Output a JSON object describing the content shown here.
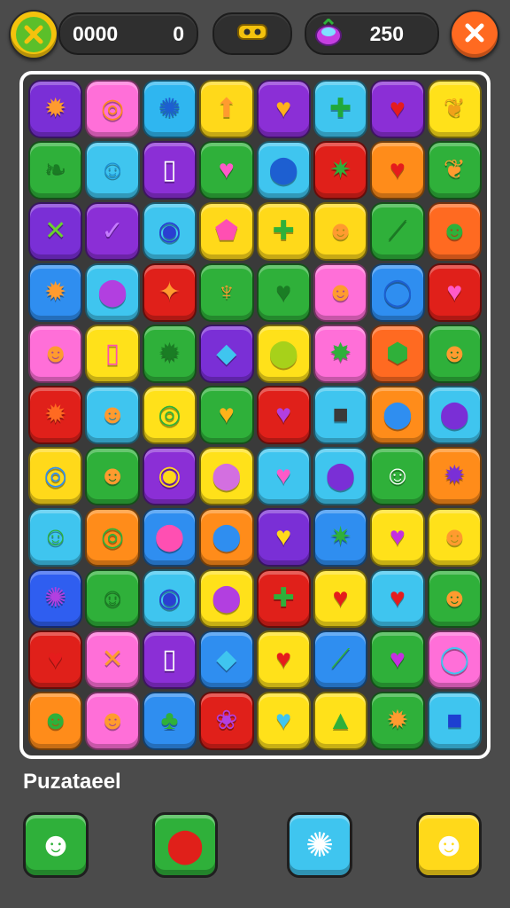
{
  "hud": {
    "score_label": "0000",
    "score_value": "0",
    "coins_value": "250",
    "left_button_icon": "check-icon",
    "right_button_icon": "close-icon",
    "center_icon": "mask-icon",
    "gem_icon": "gem-icon"
  },
  "board": {
    "rows": [
      [
        {
          "color": "#7a2fd6",
          "icon": "sun",
          "glyph": "✹",
          "gc": "#ff9b2f"
        },
        {
          "color": "#ff6fd8",
          "icon": "swirl",
          "glyph": "◎",
          "gc": "#ff8a1f"
        },
        {
          "color": "#2fb6f0",
          "icon": "gear",
          "glyph": "✺",
          "gc": "#1d5fd1"
        },
        {
          "color": "#ffd91a",
          "icon": "arrow-up",
          "glyph": "⬆",
          "gc": "#ff9b2f"
        },
        {
          "color": "#8b2fd6",
          "icon": "heart",
          "glyph": "♥",
          "gc": "#ffb21a"
        },
        {
          "color": "#3fc5ef",
          "icon": "cross",
          "glyph": "✚",
          "gc": "#20a83a"
        },
        {
          "color": "#8b2fd6",
          "icon": "heart",
          "glyph": "♥",
          "gc": "#e51c1c"
        },
        {
          "color": "#ffe11a",
          "icon": "leaf",
          "glyph": "❦",
          "gc": "#f0a21a"
        }
      ],
      [
        {
          "color": "#2fb03a",
          "icon": "leaf",
          "glyph": "❧",
          "gc": "#1a7d24"
        },
        {
          "color": "#3fc5ef",
          "icon": "smiley",
          "glyph": "☺",
          "gc": "#1d8fd1"
        },
        {
          "color": "#8b2fd6",
          "icon": "battery",
          "glyph": "▯",
          "gc": "#ffffff"
        },
        {
          "color": "#2fb03a",
          "icon": "heart",
          "glyph": "♥",
          "gc": "#ff5ac8"
        },
        {
          "color": "#3fc5ef",
          "icon": "drop",
          "glyph": "⬤",
          "gc": "#1d5fd1"
        },
        {
          "color": "#e0201a",
          "icon": "leaf",
          "glyph": "✷",
          "gc": "#2fb03a"
        },
        {
          "color": "#ff8c1a",
          "icon": "heart",
          "glyph": "♥",
          "gc": "#e51c1c"
        },
        {
          "color": "#2fb03a",
          "icon": "leaf",
          "glyph": "❦",
          "gc": "#ff9b2f"
        }
      ],
      [
        {
          "color": "#7a2fd6",
          "icon": "leaf",
          "glyph": "✕",
          "gc": "#6ad12f"
        },
        {
          "color": "#8b2fd6",
          "icon": "chevron",
          "glyph": "✓",
          "gc": "#c57bff"
        },
        {
          "color": "#3fc5ef",
          "icon": "ring",
          "glyph": "◉",
          "gc": "#2a3fd1"
        },
        {
          "color": "#ffd91a",
          "icon": "house",
          "glyph": "⬟",
          "gc": "#ff4fb2"
        },
        {
          "color": "#ffd91a",
          "icon": "cross",
          "glyph": "✚",
          "gc": "#2fb03a"
        },
        {
          "color": "#ffd91a",
          "icon": "face",
          "glyph": "☻",
          "gc": "#ff9b2f"
        },
        {
          "color": "#2fb03a",
          "icon": "leaf",
          "glyph": "⟋",
          "gc": "#1a7d24"
        },
        {
          "color": "#ff6a21",
          "icon": "face",
          "glyph": "☻",
          "gc": "#2fb03a"
        }
      ],
      [
        {
          "color": "#2f8ef0",
          "icon": "sun",
          "glyph": "✹",
          "gc": "#ff9b2f"
        },
        {
          "color": "#3fc5ef",
          "icon": "drop",
          "glyph": "⬤",
          "gc": "#b23fe0"
        },
        {
          "color": "#e0201a",
          "icon": "cat",
          "glyph": "✦",
          "gc": "#ff9b2f"
        },
        {
          "color": "#2fb03a",
          "icon": "carrot",
          "glyph": "♆",
          "gc": "#ff9b2f"
        },
        {
          "color": "#2fb03a",
          "icon": "heart",
          "glyph": "♥",
          "gc": "#1a7d24"
        },
        {
          "color": "#ff6fd8",
          "icon": "face",
          "glyph": "☻",
          "gc": "#ff9b2f"
        },
        {
          "color": "#2f8ef0",
          "icon": "ring",
          "glyph": "◯",
          "gc": "#1d5fd1"
        },
        {
          "color": "#e0201a",
          "icon": "heart",
          "glyph": "♥",
          "gc": "#ff5ac8"
        }
      ],
      [
        {
          "color": "#ff6fd8",
          "icon": "face",
          "glyph": "☻",
          "gc": "#ff9b2f"
        },
        {
          "color": "#ffe11a",
          "icon": "battery",
          "glyph": "▯",
          "gc": "#ff4fb2"
        },
        {
          "color": "#2fb03a",
          "icon": "sun",
          "glyph": "✹",
          "gc": "#1a7d24"
        },
        {
          "color": "#7a2fd6",
          "icon": "crystal",
          "glyph": "◆",
          "gc": "#3fc5ef"
        },
        {
          "color": "#ffe11a",
          "icon": "pin",
          "glyph": "⬤",
          "gc": "#a7d11a"
        },
        {
          "color": "#ff6fd8",
          "icon": "leaf",
          "glyph": "✸",
          "gc": "#2fb03a"
        },
        {
          "color": "#ff6a21",
          "icon": "leaf",
          "glyph": "⬢",
          "gc": "#2fb03a"
        },
        {
          "color": "#2fb03a",
          "icon": "face",
          "glyph": "☻",
          "gc": "#ff9b2f"
        }
      ],
      [
        {
          "color": "#e0201a",
          "icon": "bug",
          "glyph": "✹",
          "gc": "#ff6a21"
        },
        {
          "color": "#3fc5ef",
          "icon": "face",
          "glyph": "☻",
          "gc": "#ff9b2f"
        },
        {
          "color": "#ffe11a",
          "icon": "swirl",
          "glyph": "◎",
          "gc": "#2fb03a"
        },
        {
          "color": "#2fb03a",
          "icon": "heart",
          "glyph": "♥",
          "gc": "#ffb21a"
        },
        {
          "color": "#e0201a",
          "icon": "heart",
          "glyph": "♥",
          "gc": "#b23fe0"
        },
        {
          "color": "#3fc5ef",
          "icon": "block",
          "glyph": "■",
          "gc": "#3a3a3a"
        },
        {
          "color": "#ff8c1a",
          "icon": "drop",
          "glyph": "⬤",
          "gc": "#2f8ef0"
        },
        {
          "color": "#3fc5ef",
          "icon": "ball",
          "glyph": "⬤",
          "gc": "#7a2fd6"
        }
      ],
      [
        {
          "color": "#ffd91a",
          "icon": "swirl",
          "glyph": "◎",
          "gc": "#2f8ef0"
        },
        {
          "color": "#2fb03a",
          "icon": "face",
          "glyph": "☻",
          "gc": "#ff9b2f"
        },
        {
          "color": "#8b2fd6",
          "icon": "ring",
          "glyph": "◉",
          "gc": "#ffd91a"
        },
        {
          "color": "#ffe11a",
          "icon": "drop",
          "glyph": "⬤",
          "gc": "#d36fe0"
        },
        {
          "color": "#3fc5ef",
          "icon": "heart",
          "glyph": "♥",
          "gc": "#ff5ac8"
        },
        {
          "color": "#3fc5ef",
          "icon": "egg",
          "glyph": "⬤",
          "gc": "#7a2fd6"
        },
        {
          "color": "#2fb03a",
          "icon": "smiley",
          "glyph": "☺",
          "gc": "#ffffff"
        },
        {
          "color": "#ff8c1a",
          "icon": "bug",
          "glyph": "✹",
          "gc": "#7a2fd6"
        }
      ],
      [
        {
          "color": "#3fc5ef",
          "icon": "smiley",
          "glyph": "☺",
          "gc": "#2fb03a"
        },
        {
          "color": "#ff8c1a",
          "icon": "swirl",
          "glyph": "◎",
          "gc": "#2fb03a"
        },
        {
          "color": "#2f8ef0",
          "icon": "ball",
          "glyph": "⬤",
          "gc": "#ff4fb2"
        },
        {
          "color": "#ff8c1a",
          "icon": "drop",
          "glyph": "⬤",
          "gc": "#2f8ef0"
        },
        {
          "color": "#7a2fd6",
          "icon": "heart",
          "glyph": "♥",
          "gc": "#ffd91a"
        },
        {
          "color": "#2f8ef0",
          "icon": "leaf",
          "glyph": "✷",
          "gc": "#2fb03a"
        },
        {
          "color": "#ffe11a",
          "icon": "heart",
          "glyph": "♥",
          "gc": "#c52fe0"
        },
        {
          "color": "#ffe11a",
          "icon": "face",
          "glyph": "☻",
          "gc": "#ff9b2f"
        }
      ],
      [
        {
          "color": "#2f5ef0",
          "icon": "burst",
          "glyph": "✺",
          "gc": "#b23fe0"
        },
        {
          "color": "#2fb03a",
          "icon": "smiley",
          "glyph": "☺",
          "gc": "#1a7d24"
        },
        {
          "color": "#3fc5ef",
          "icon": "ring",
          "glyph": "◉",
          "gc": "#2a3fd1"
        },
        {
          "color": "#ffe11a",
          "icon": "cup",
          "glyph": "⬤",
          "gc": "#b23fe0"
        },
        {
          "color": "#e0201a",
          "icon": "cross",
          "glyph": "✚",
          "gc": "#2fb03a"
        },
        {
          "color": "#ffe11a",
          "icon": "heart",
          "glyph": "♥",
          "gc": "#e51c1c"
        },
        {
          "color": "#3fc5ef",
          "icon": "heart",
          "glyph": "♥",
          "gc": "#e51c1c"
        },
        {
          "color": "#2fb03a",
          "icon": "face",
          "glyph": "☻",
          "gc": "#ff9b2f"
        }
      ],
      [
        {
          "color": "#e0201a",
          "icon": "heart",
          "glyph": "♥",
          "gc": "#e51c1c"
        },
        {
          "color": "#ff6fd8",
          "icon": "lollipop",
          "glyph": "✕",
          "gc": "#ff9b2f"
        },
        {
          "color": "#8b2fd6",
          "icon": "battery",
          "glyph": "▯",
          "gc": "#ffffff"
        },
        {
          "color": "#2f8ef0",
          "icon": "crystal",
          "glyph": "◆",
          "gc": "#3fc5ef"
        },
        {
          "color": "#ffe11a",
          "icon": "heart",
          "glyph": "♥",
          "gc": "#e51c1c"
        },
        {
          "color": "#2f8ef0",
          "icon": "leaf",
          "glyph": "⟋",
          "gc": "#2fb03a"
        },
        {
          "color": "#2fb03a",
          "icon": "heart",
          "glyph": "♥",
          "gc": "#c52fe0"
        },
        {
          "color": "#ff6fd8",
          "icon": "ring",
          "glyph": "◯",
          "gc": "#3fc5ef"
        }
      ],
      [
        {
          "color": "#ff8c1a",
          "icon": "frog",
          "glyph": "☻",
          "gc": "#2fb03a"
        },
        {
          "color": "#ff6fd8",
          "icon": "face",
          "glyph": "☻",
          "gc": "#ff9b2f"
        },
        {
          "color": "#2f8ef0",
          "icon": "plant",
          "glyph": "♣",
          "gc": "#2fb03a"
        },
        {
          "color": "#e0201a",
          "icon": "grapes",
          "glyph": "❀",
          "gc": "#b23fe0"
        },
        {
          "color": "#ffe11a",
          "icon": "heart",
          "glyph": "♥",
          "gc": "#3fc5ef"
        },
        {
          "color": "#ffe11a",
          "icon": "tree",
          "glyph": "▲",
          "gc": "#2fb03a"
        },
        {
          "color": "#2fb03a",
          "icon": "sun",
          "glyph": "✹",
          "gc": "#ff9b2f"
        },
        {
          "color": "#3fc5ef",
          "icon": "block",
          "glyph": "■",
          "gc": "#1d3fd1"
        }
      ]
    ]
  },
  "footer": {
    "label": "Puzataeel",
    "boosters": [
      {
        "name": "booster-ghost-green",
        "color": "#2fb03a",
        "glyph": "☻",
        "gc": "#ffffff"
      },
      {
        "name": "booster-ball-red",
        "color": "#2fb03a",
        "glyph": "⬤",
        "gc": "#e0201a"
      },
      {
        "name": "booster-critter-blue",
        "color": "#3fc5ef",
        "glyph": "✺",
        "gc": "#ffffff"
      },
      {
        "name": "booster-ghost-yellow",
        "color": "#ffd91a",
        "glyph": "☻",
        "gc": "#ffffff"
      }
    ]
  }
}
